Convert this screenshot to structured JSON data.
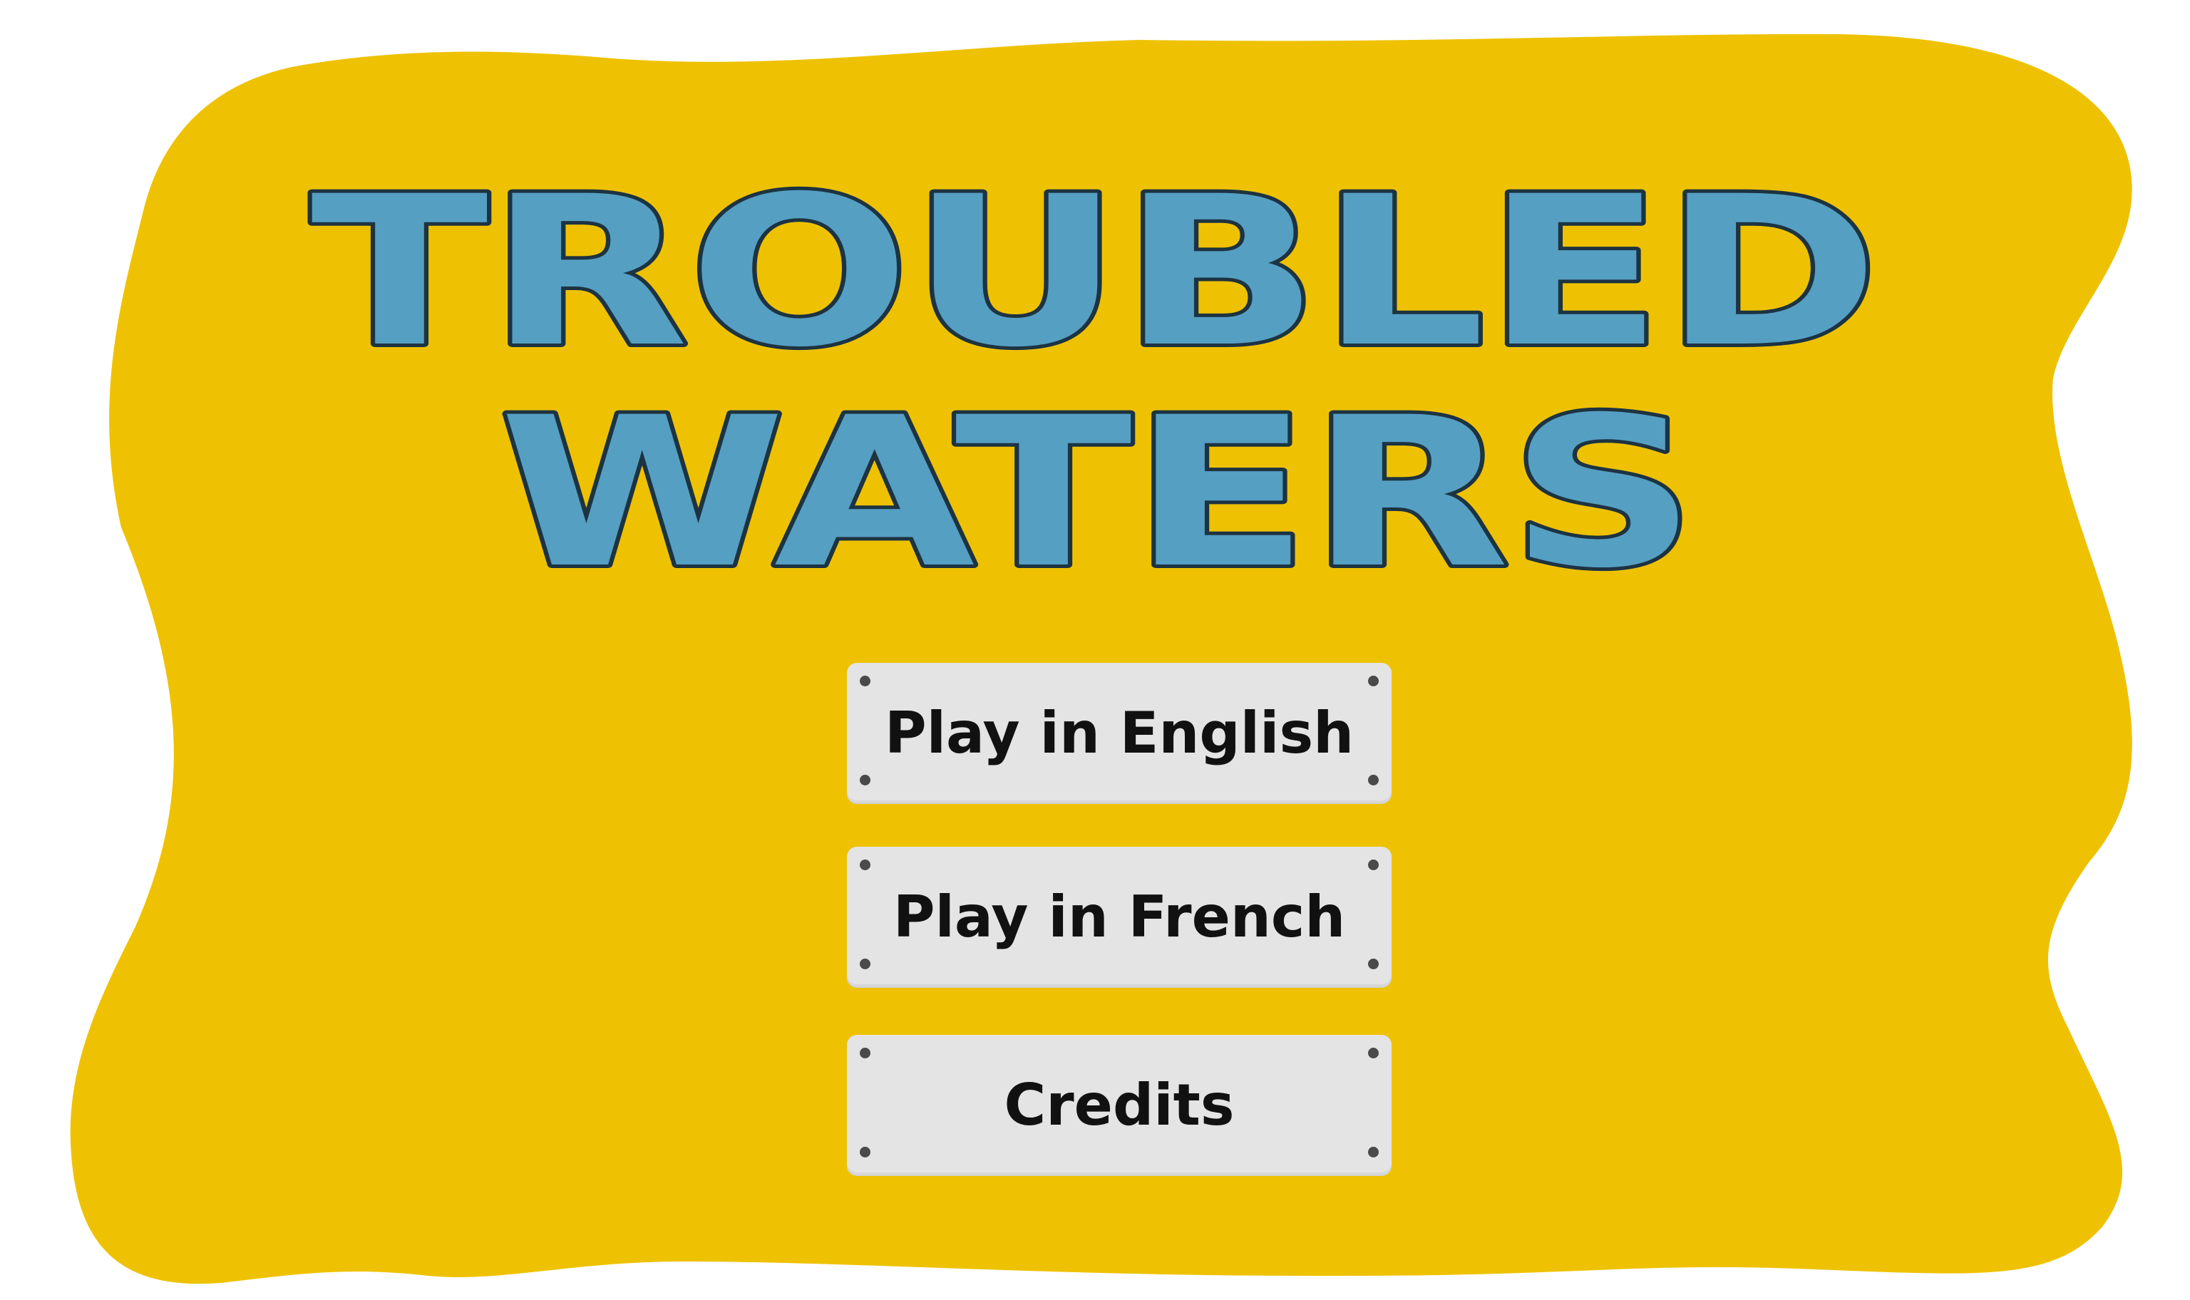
{
  "colors": {
    "background": "#ffffff",
    "panel": "#eec203",
    "title_fill": "#559fc3",
    "title_outline": "#1d3341",
    "button_face": "#e4e4e4",
    "button_text": "#111111",
    "rivet": "#4a4a4a"
  },
  "title": {
    "line1": "TROUBLED",
    "line2": "WATERS"
  },
  "menu": {
    "buttons": [
      {
        "label": "Play in English"
      },
      {
        "label": "Play in French"
      },
      {
        "label": "Credits"
      }
    ]
  }
}
